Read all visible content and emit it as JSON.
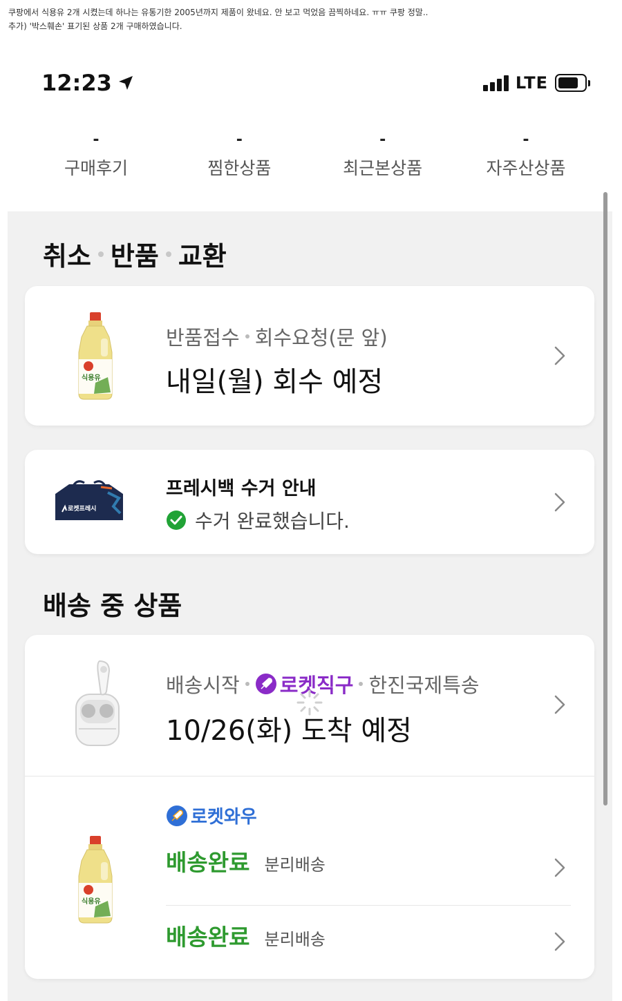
{
  "caption": {
    "line1": "쿠팡에서 식용유 2개 시켰는데 하나는 유통기한 2005년까지 제품이 왔네요. 안 보고 먹었음 끔찍하네요. ㅠㅠ 쿠팡 정말..",
    "line2": "추가) '박스훼손' 표기된 상품 2개 구매하였습니다."
  },
  "status_bar": {
    "time": "12:23",
    "network": "LTE",
    "battery_level": 0.78
  },
  "stats": [
    {
      "value": "-",
      "label": "구매후기"
    },
    {
      "value": "-",
      "label": "찜한상품"
    },
    {
      "value": "-",
      "label": "최근본상품"
    },
    {
      "value": "-",
      "label": "자주산상품"
    }
  ],
  "returns_section": {
    "title_part1": "취소",
    "title_part2": "반품",
    "title_part3": "교환",
    "return_card": {
      "status": "반품접수",
      "method": "회수요청(문 앞)",
      "schedule": "내일(월) 회수 예정"
    },
    "fresh_bag_card": {
      "title": "프레시백 수거 안내",
      "status": "수거 완료했습니다.",
      "bag_brand": "로켓프레시"
    }
  },
  "shipping_section": {
    "title": "배송 중 상품",
    "jikgu_card": {
      "status": "배송시작",
      "badge": "로켓직구",
      "carrier": "한진국제특송",
      "eta": "10/26(화) 도착 예정"
    },
    "wow_card": {
      "badge": "로켓와우",
      "product_label": "식용유",
      "items": [
        {
          "status": "배송완료",
          "note": "분리배송"
        },
        {
          "status": "배송완료",
          "note": "분리배송"
        }
      ]
    }
  },
  "colors": {
    "delivered_green": "#2e9a2f",
    "jikgu_purple": "#8a2bc7",
    "wow_blue": "#2f6fd6",
    "check_green": "#21a336"
  }
}
